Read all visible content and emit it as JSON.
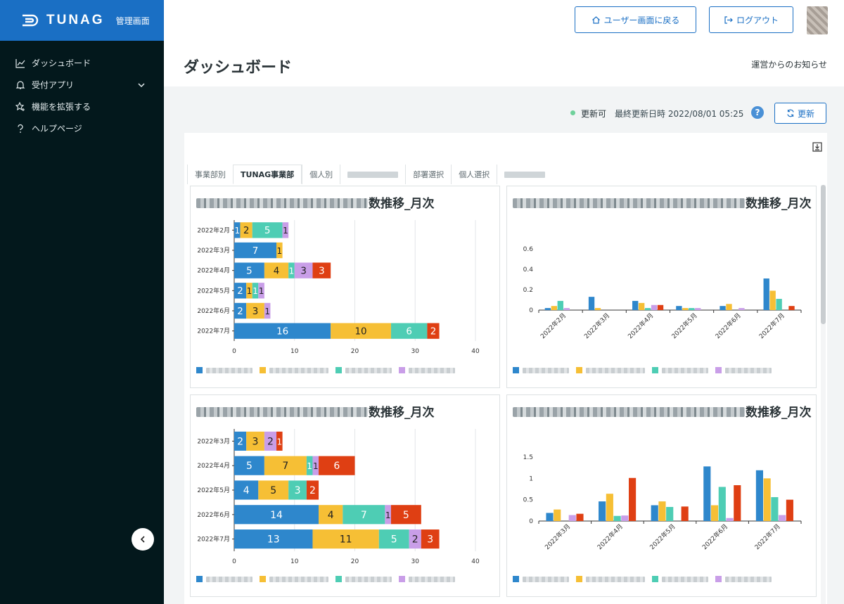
{
  "brand": {
    "name": "TUNAG",
    "subtitle": "管理画面"
  },
  "sidebar": {
    "items": [
      {
        "label": "ダッシュボード",
        "icon": "chart-line-icon"
      },
      {
        "label": "受付アプリ",
        "icon": "bell-icon"
      },
      {
        "label": "機能を拡張する",
        "icon": "star-plus-icon"
      },
      {
        "label": "ヘルプページ",
        "icon": "question-icon"
      }
    ]
  },
  "header": {
    "user_screen_button": "ユーザー画面に戻る",
    "logout_button": "ログアウト"
  },
  "page": {
    "title": "ダッシュボード",
    "notice_link": "運営からのお知らせ"
  },
  "status": {
    "state": "更新可",
    "last_updated": "最終更新日時 2022/08/01 05:25",
    "help": "?",
    "refresh_button": "更新"
  },
  "tabs": [
    {
      "label": "事業部別"
    },
    {
      "label": "TUNAG事業部",
      "active": true
    },
    {
      "label": "個人別"
    },
    {
      "label": ""
    },
    {
      "label": "部署選択"
    },
    {
      "label": "個人選択"
    },
    {
      "label": ""
    }
  ],
  "colors": {
    "blue": "#2e87cc",
    "yellow": "#f6bf35",
    "teal": "#4ecdb4",
    "purple": "#c99ee8",
    "red": "#df3f13",
    "accent": "#1a6fc4"
  },
  "chart_data": [
    {
      "type": "bar",
      "orientation": "horizontal",
      "stacked": true,
      "title": "数推移_月次",
      "categories": [
        "2022年2月",
        "2022年3月",
        "2022年4月",
        "2022年5月",
        "2022年6月",
        "2022年7月"
      ],
      "series": [
        {
          "values": [
            1,
            7,
            5,
            2,
            2,
            16
          ],
          "color": "#2e87cc"
        },
        {
          "values": [
            2,
            1,
            4,
            1,
            3,
            10
          ],
          "color": "#f6bf35"
        },
        {
          "values": [
            5,
            0,
            1,
            1,
            0,
            6
          ],
          "color": "#4ecdb4"
        },
        {
          "values": [
            1,
            0,
            3,
            1,
            1,
            0
          ],
          "color": "#c99ee8"
        },
        {
          "values": [
            0,
            0,
            3,
            0,
            0,
            2
          ],
          "color": "#df3f13"
        }
      ],
      "xlim": [
        0,
        40
      ],
      "xticks": [
        "0",
        "10",
        "20",
        "30",
        "40"
      ],
      "grid": true
    },
    {
      "type": "bar",
      "title": "数推移_月次",
      "categories": [
        "2022年2月",
        "2022年3月",
        "2022年4月",
        "2022年5月",
        "2022年6月",
        "2022年7月"
      ],
      "series": [
        {
          "values": [
            0.02,
            0.13,
            0.09,
            0.04,
            0.04,
            0.31
          ],
          "color": "#2e87cc"
        },
        {
          "values": [
            0.04,
            0.02,
            0.07,
            0.02,
            0.06,
            0.19
          ],
          "color": "#f6bf35"
        },
        {
          "values": [
            0.09,
            0,
            0.02,
            0.02,
            0,
            0.11
          ],
          "color": "#4ecdb4"
        },
        {
          "values": [
            0.02,
            0,
            0.05,
            0.02,
            0.02,
            0
          ],
          "color": "#c99ee8"
        },
        {
          "values": [
            0,
            0,
            0.05,
            0,
            0,
            0.04
          ],
          "color": "#df3f13"
        }
      ],
      "ylim": [
        0,
        0.6
      ],
      "yticks": [
        "0",
        "0.2",
        "0.4",
        "0.6"
      ],
      "grid": false
    },
    {
      "type": "bar",
      "orientation": "horizontal",
      "stacked": true,
      "title": "数推移_月次",
      "categories": [
        "2022年3月",
        "2022年4月",
        "2022年5月",
        "2022年6月",
        "2022年7月"
      ],
      "series": [
        {
          "values": [
            2,
            5,
            4,
            14,
            13
          ],
          "color": "#2e87cc"
        },
        {
          "values": [
            3,
            7,
            5,
            4,
            11
          ],
          "color": "#f6bf35"
        },
        {
          "values": [
            0,
            1,
            3,
            7,
            5
          ],
          "color": "#4ecdb4"
        },
        {
          "values": [
            2,
            1,
            0,
            1,
            2
          ],
          "color": "#c99ee8"
        },
        {
          "values": [
            1,
            6,
            2,
            5,
            3
          ],
          "color": "#df3f13"
        }
      ],
      "xlim": [
        0,
        40
      ],
      "xticks": [
        "0",
        "10",
        "20",
        "30",
        "40"
      ],
      "grid": true
    },
    {
      "type": "bar",
      "title": "数推移_月次",
      "categories": [
        "2022年3月",
        "2022年4月",
        "2022年5月",
        "2022年6月",
        "2022年7月"
      ],
      "series": [
        {
          "values": [
            0.19,
            0.46,
            0.37,
            1.28,
            1.19
          ],
          "color": "#2e87cc"
        },
        {
          "values": [
            0.27,
            0.64,
            0.46,
            0.37,
            1.0
          ],
          "color": "#f6bf35"
        },
        {
          "values": [
            0,
            0.12,
            0.33,
            0.8,
            0.56
          ],
          "color": "#4ecdb4"
        },
        {
          "values": [
            0.14,
            0.13,
            0,
            0.07,
            0.14
          ],
          "color": "#c99ee8"
        },
        {
          "values": [
            0.17,
            1.01,
            0.34,
            0.84,
            0.5
          ],
          "color": "#df3f13"
        }
      ],
      "ylim": [
        0,
        1.5
      ],
      "yticks": [
        "0",
        "0.5",
        "1",
        "1.5"
      ],
      "grid": false
    }
  ]
}
